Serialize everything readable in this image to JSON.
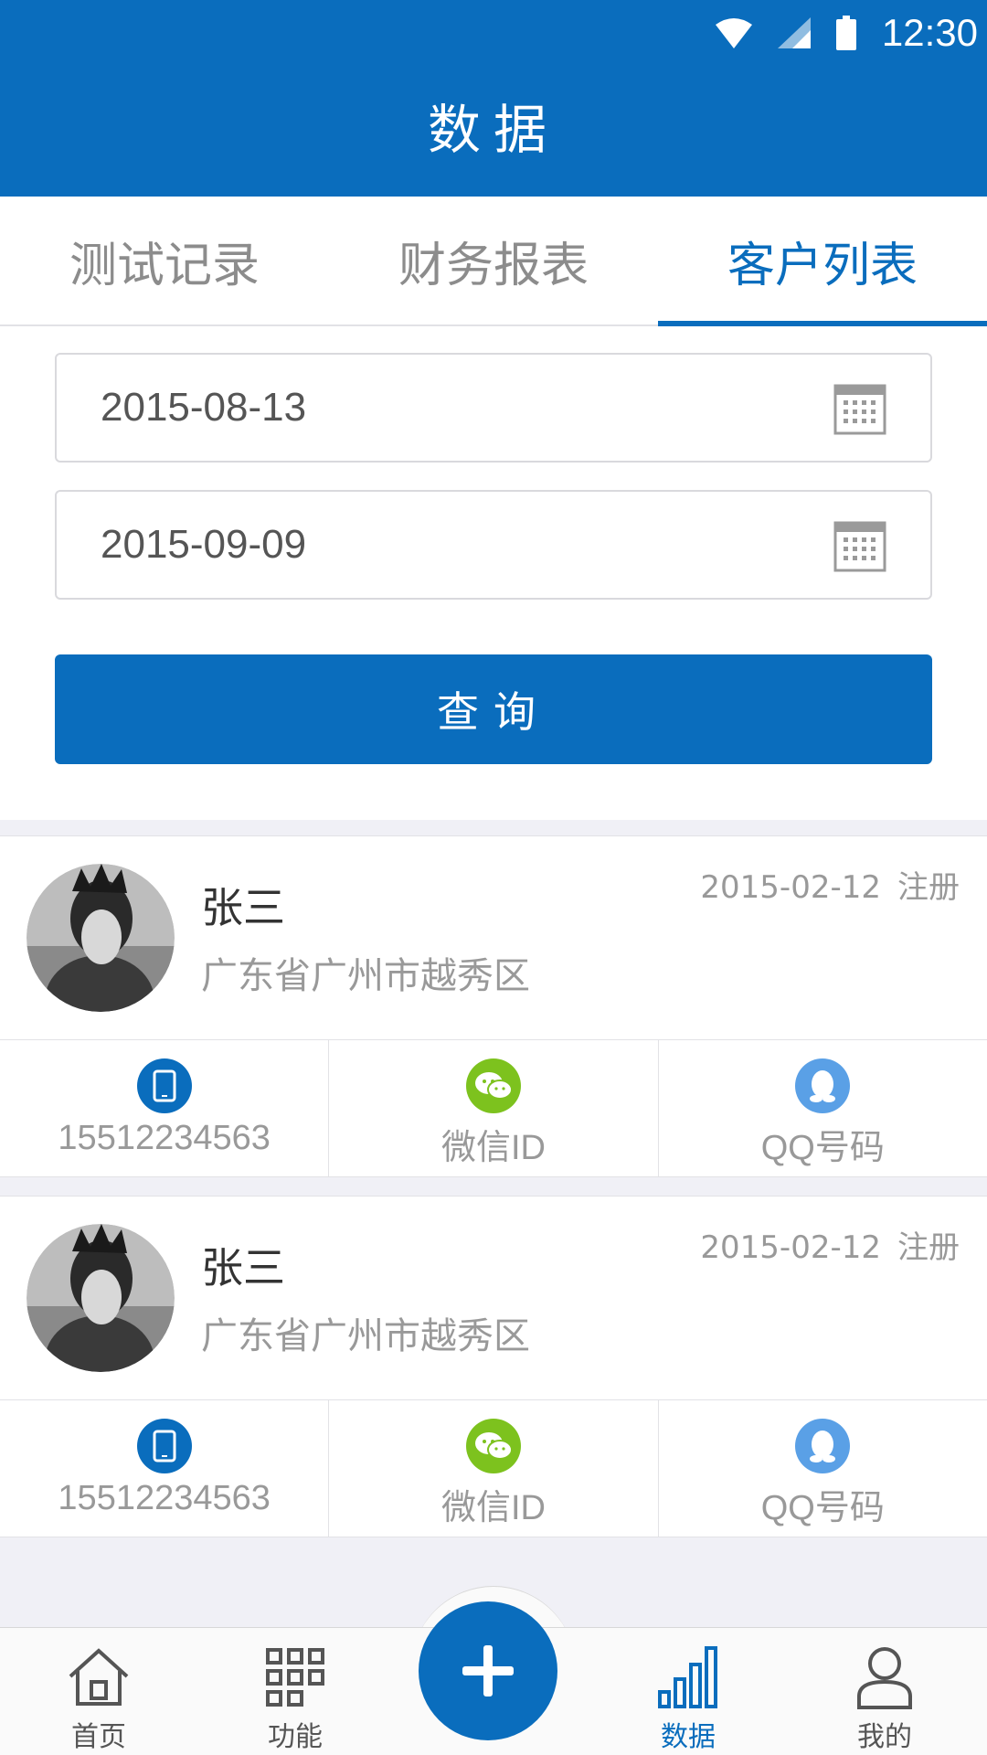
{
  "status": {
    "time": "12:30"
  },
  "header": {
    "title": "数据"
  },
  "tabs": [
    {
      "label": "测试记录",
      "active": false
    },
    {
      "label": "财务报表",
      "active": false
    },
    {
      "label": "客户列表",
      "active": true
    }
  ],
  "search": {
    "start_date": "2015-08-13",
    "end_date": "2015-09-09",
    "button_label": "查询"
  },
  "customers": [
    {
      "name": "张三",
      "address": "广东省广州市越秀区",
      "date": "2015-02-12",
      "date_suffix": "注册",
      "phone": "15512234563",
      "wechat": "微信ID",
      "qq": "QQ号码"
    },
    {
      "name": "张三",
      "address": "广东省广州市越秀区",
      "date": "2015-02-12",
      "date_suffix": "注册",
      "phone": "15512234563",
      "wechat": "微信ID",
      "qq": "QQ号码"
    }
  ],
  "nav": {
    "home": "首页",
    "features": "功能",
    "data": "数据",
    "mine": "我的",
    "active": "data"
  },
  "colors": {
    "primary": "#0a6dbd",
    "wechat": "#7dc21e",
    "qq": "#5aa0e6"
  }
}
